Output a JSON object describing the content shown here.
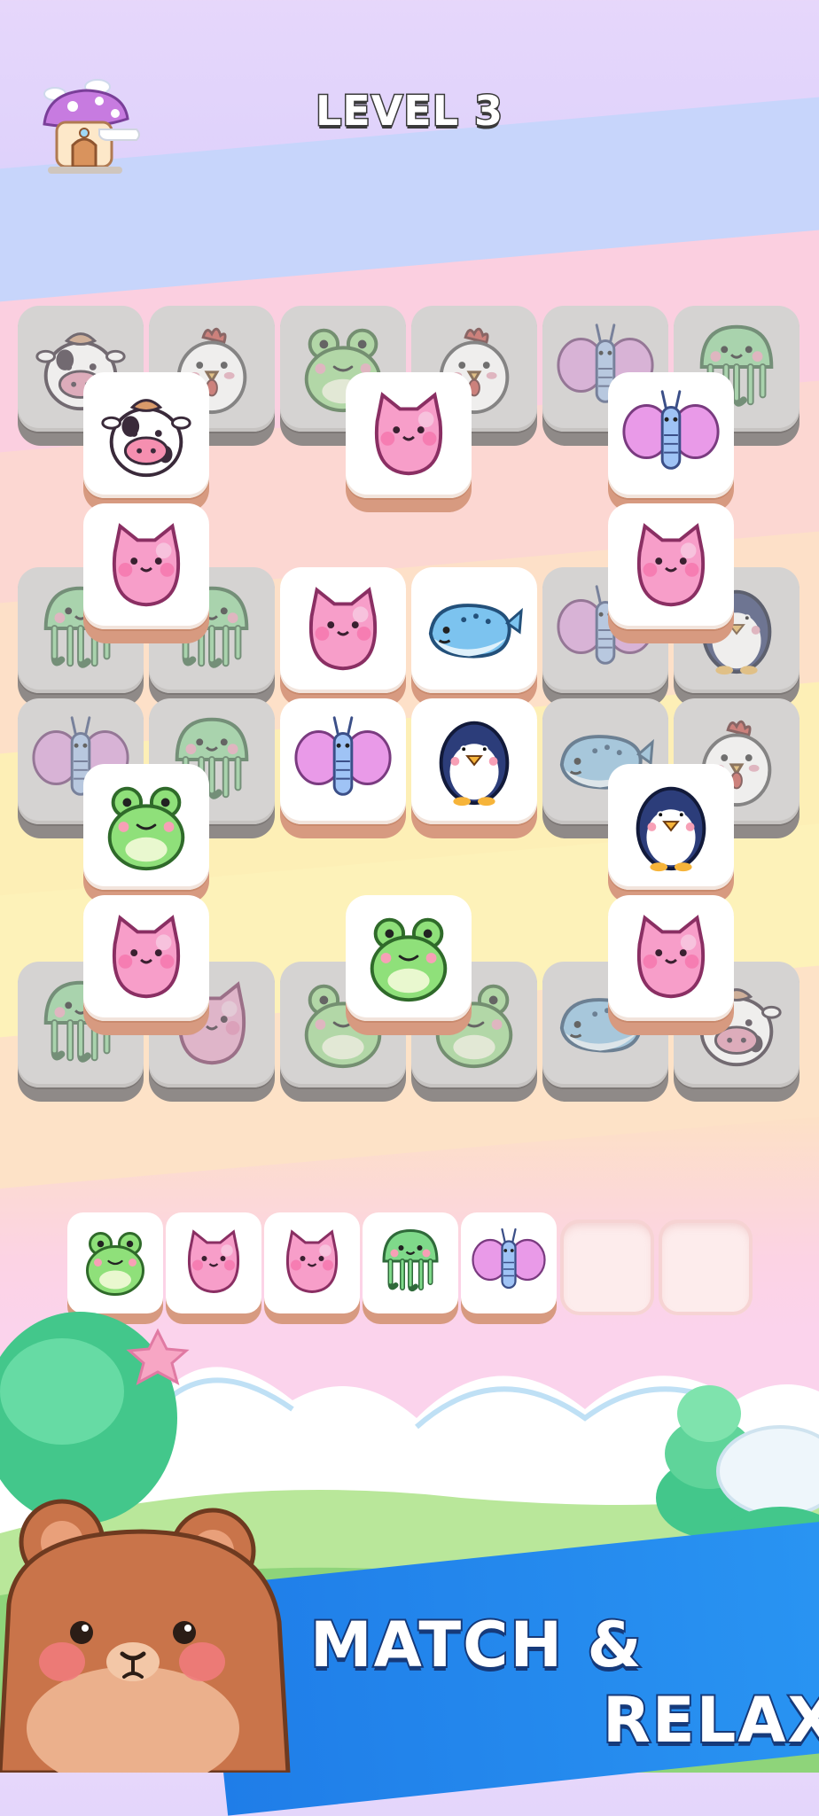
{
  "header": {
    "level_label": "LEVEL 3",
    "home_icon": "mushroom-house-icon"
  },
  "board": {
    "tile_icons": [
      "cow-icon",
      "chicken-icon",
      "frog-icon",
      "cat-icon",
      "butterfly-icon",
      "jellyfish-icon",
      "whale-icon",
      "penguin-icon"
    ]
  },
  "tray": {
    "capacity": 7,
    "items": [
      "frog-icon",
      "cat-icon",
      "cat-icon",
      "jellyfish-icon",
      "butterfly-icon"
    ]
  },
  "promo": {
    "line1": "MATCH &",
    "line2": "RELAX",
    "mascot": "bear-icon"
  },
  "colors": {
    "tile_face": "#ffffff",
    "tile_base": "#d79a80",
    "banner_blue": "#2a8df0"
  }
}
